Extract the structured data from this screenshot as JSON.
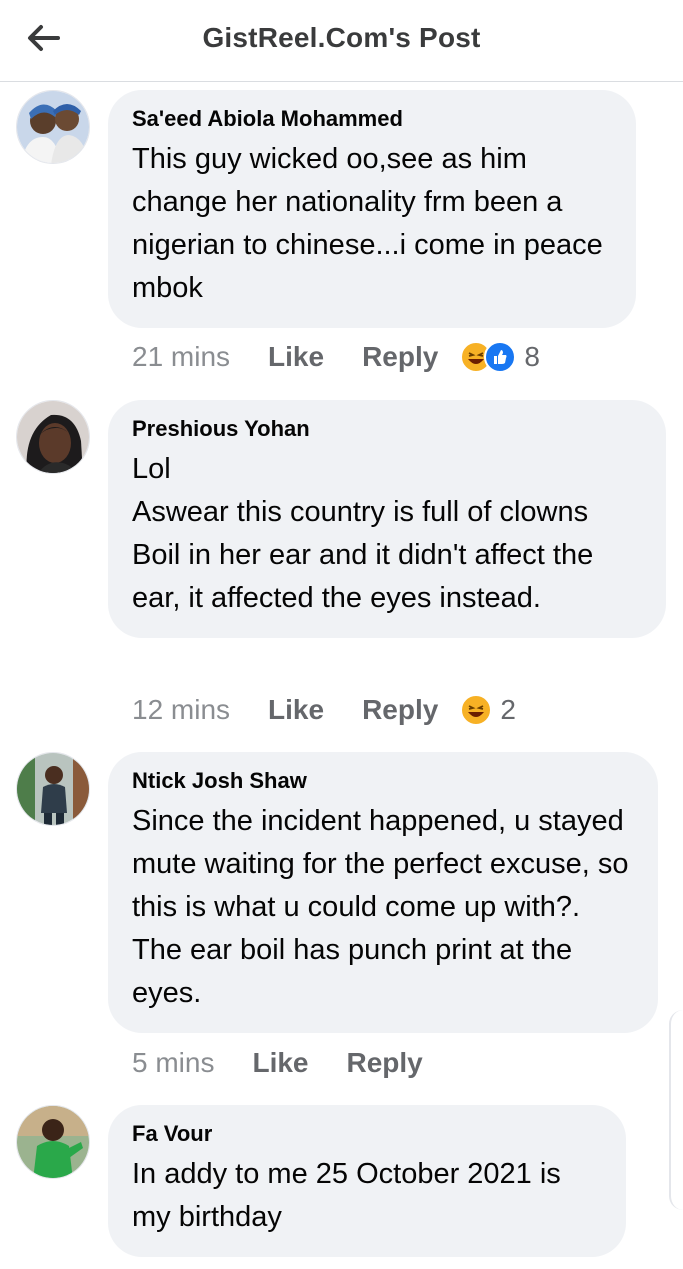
{
  "header": {
    "title": "GistReel.Com's Post",
    "back_icon": "arrow-left-icon"
  },
  "comments": [
    {
      "author": "Sa'eed Abiola Mohammed",
      "text": "This guy wicked oo,see as him change her nationality frm been a nigerian to chinese...i come in peace mbok",
      "time": "21 mins",
      "like": "Like",
      "reply": "Reply",
      "reactions": [
        "laugh-emoji-icon",
        "like-emoji-icon"
      ],
      "reaction_count": "8"
    },
    {
      "author": "Preshious Yohan",
      "text": "Lol\nAswear this country is full of clowns\nBoil in her ear and it didn't affect the ear, it affected the eyes instead.",
      "time": "12 mins",
      "like": "Like",
      "reply": "Reply",
      "reactions": [
        "laugh-emoji-icon"
      ],
      "reaction_count": "2"
    },
    {
      "author": "Ntick Josh Shaw",
      "text": "Since the incident happened, u stayed mute waiting for the perfect excuse, so this is what u could come up with?. The ear boil has punch print at the eyes.",
      "time": "5 mins",
      "like": "Like",
      "reply": "Reply"
    },
    {
      "author": "Fa Vour",
      "text": "In addy to me 25 October 2021 is my birthday"
    }
  ],
  "colors": {
    "bubble": "#f0f2f5",
    "secondary_text": "#65676b",
    "like_blue": "#1877f2",
    "emoji_yellow": "#f7b125"
  }
}
